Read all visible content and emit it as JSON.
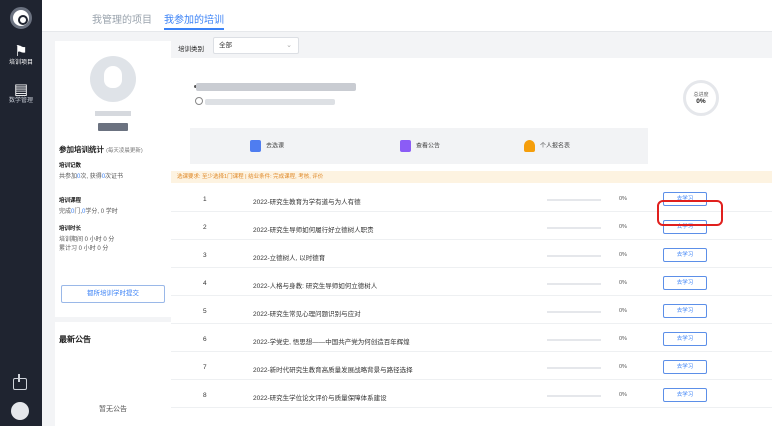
{
  "rail": {
    "nav": [
      {
        "icon": "flag-icon",
        "label": "培训项目",
        "active": true
      },
      {
        "icon": "doc-icon",
        "label": "数学管理",
        "active": false
      }
    ]
  },
  "tabs": [
    {
      "label": "我管理的项目",
      "active": false
    },
    {
      "label": "我参加的培训",
      "active": true
    }
  ],
  "profile": {
    "stats_title": "参加培训统计",
    "stats_note": "(每天凌晨更新)",
    "sections": [
      {
        "label": "培训记数",
        "value_prefix": "共参加",
        "v1": "0",
        "mid": "次, 获得",
        "v2": "0",
        "suffix": "次证书"
      },
      {
        "label": "培训课程",
        "value_prefix": "完成",
        "v1": "0",
        "mid": "门,",
        "v2": "0",
        "suffix": "学分, 0 学时"
      },
      {
        "label": "培训时长",
        "line1": "培训期间 0 小时 0 分",
        "line2": "累计习 0 小时 0 分"
      }
    ],
    "sync_button": "都所培训学时提交"
  },
  "notices": {
    "title": "最新公告",
    "empty": "暂无公告"
  },
  "filter": {
    "label": "培训类别",
    "value": "全部"
  },
  "summary": {
    "progress_label": "总进度",
    "progress_value": "0%"
  },
  "actions": [
    {
      "icon": "list-icon",
      "label": "去选课"
    },
    {
      "icon": "bell-icon",
      "label": "查看公告"
    },
    {
      "icon": "user-icon",
      "label": "个人报名表"
    }
  ],
  "notice_bar": "选课要求: 至少选择1门课程 | 结业条件: 完成课程, 考核, 评价",
  "courses": [
    {
      "num": "1",
      "title": "2022-研究生教育为学有道与为人有德",
      "progress": 0,
      "pct": "0%",
      "button": "去学习"
    },
    {
      "num": "2",
      "title": "2022-研究生导师如何履行好立德树人职责",
      "progress": 0,
      "pct": "0%",
      "button": "去学习"
    },
    {
      "num": "3",
      "title": "2022-立德树人, 以时德育",
      "progress": 0,
      "pct": "0%",
      "button": "去学习"
    },
    {
      "num": "4",
      "title": "2022-人格与身教: 研究生导师如何立德树人",
      "progress": 0,
      "pct": "0%",
      "button": "去学习"
    },
    {
      "num": "5",
      "title": "2022-研究生常见心理问题识别与应对",
      "progress": 0,
      "pct": "0%",
      "button": "去学习"
    },
    {
      "num": "6",
      "title": "2022-学党史, 悟思想——中国共产党为何创造百年辉煌",
      "progress": 0,
      "pct": "0%",
      "button": "去学习"
    },
    {
      "num": "7",
      "title": "2022-新时代研究生教育高质量发展战略背景与路径选择",
      "progress": 0,
      "pct": "0%",
      "button": "去学习"
    },
    {
      "num": "8",
      "title": "2022-研究生学位论文评价与质量保障体系建设",
      "progress": 0,
      "pct": "0%",
      "button": "去学习"
    }
  ],
  "colors": {
    "accent": "#3b82f6",
    "rail": "#1f2430",
    "highlight": "#e0201e"
  }
}
